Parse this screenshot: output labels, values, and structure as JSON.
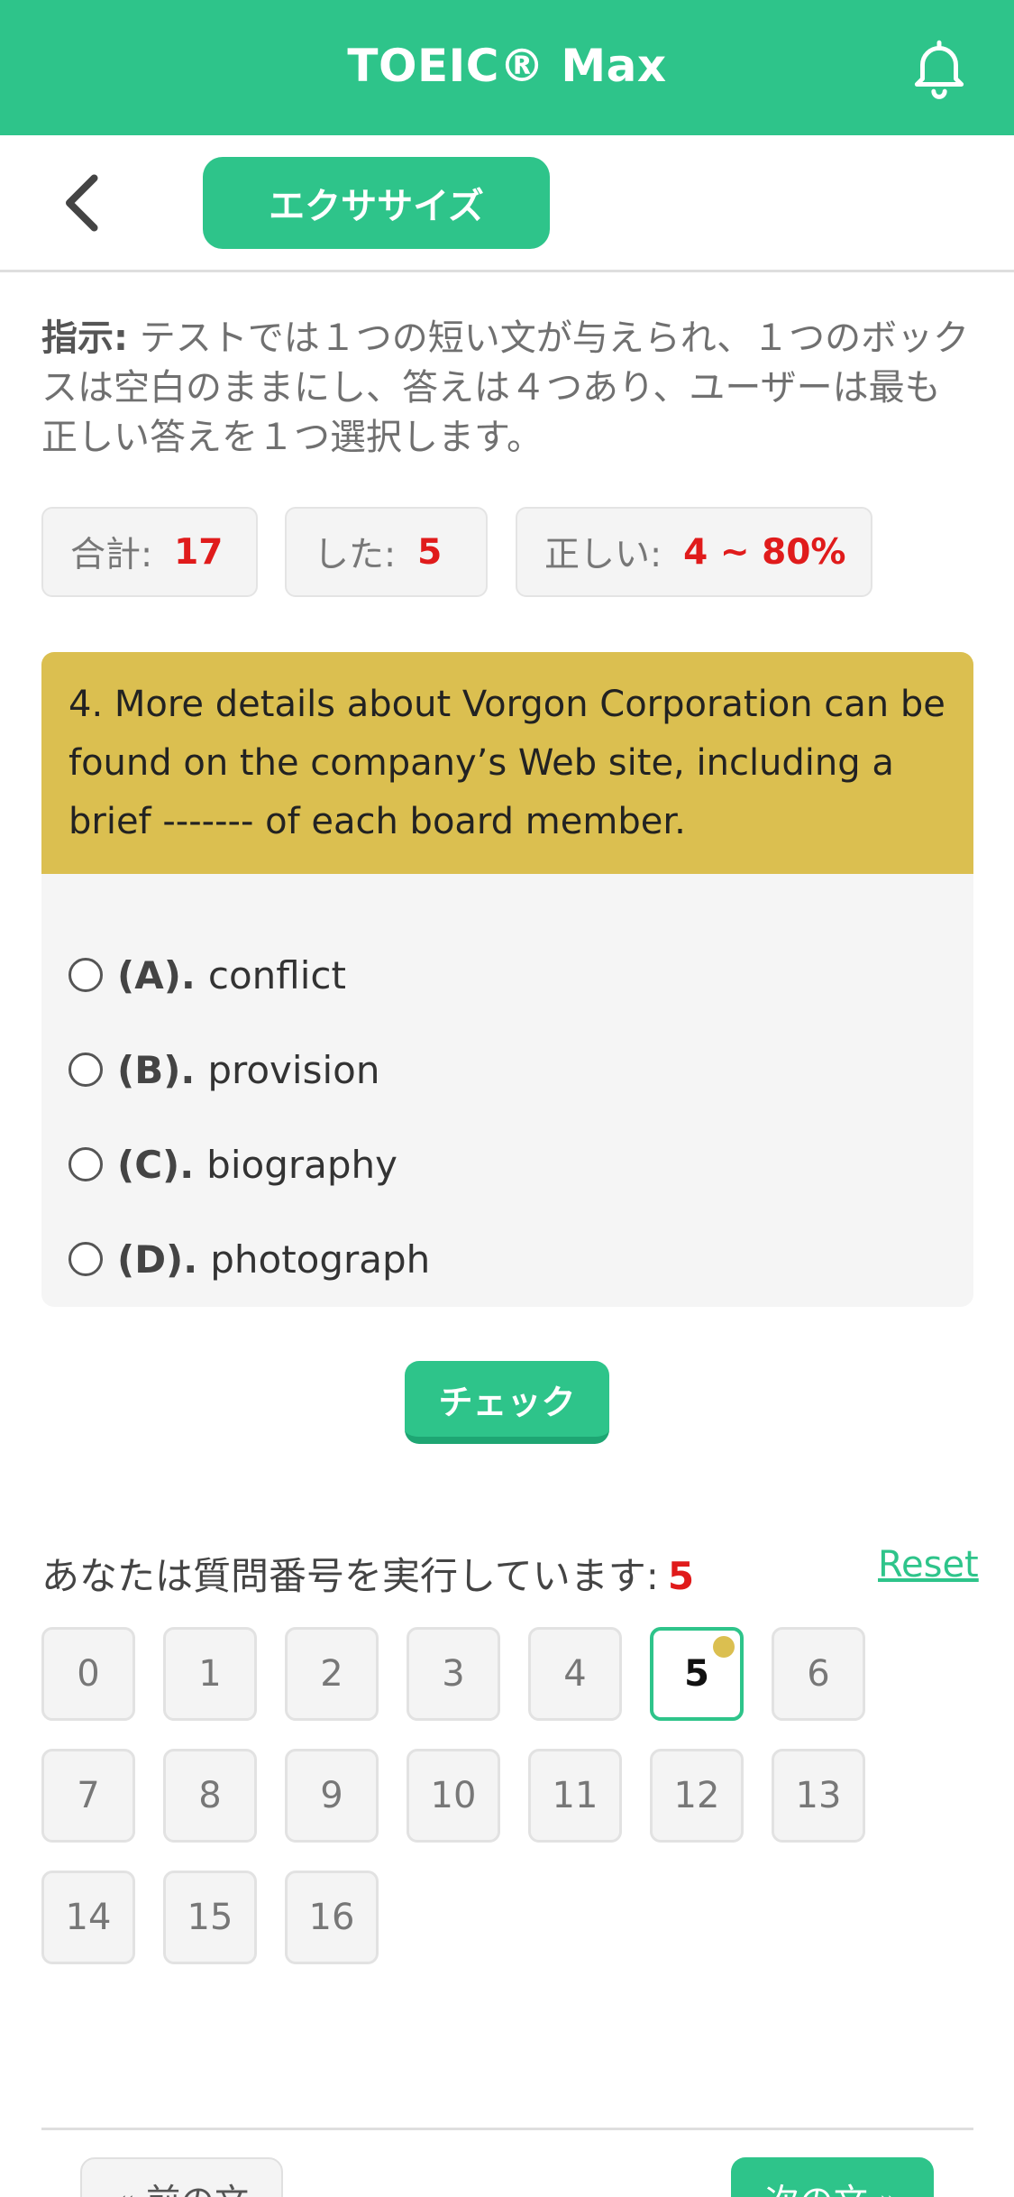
{
  "app": {
    "title": "TOEIC® Max",
    "bell_icon": "bell-icon",
    "back_icon": "chevron-left-icon"
  },
  "subnav": {
    "tab_label": "エクササイズ"
  },
  "instruction": {
    "label": "指示:",
    "text": " テストでは１つの短い文が与えられ、１つのボックスは空白のままにし、答えは４つあり、ユーザーは最も正しい答えを１つ選択します。"
  },
  "stats": {
    "total_label": "合計:",
    "total_value": "17",
    "done_label": "した:",
    "done_value": "5",
    "correct_label": "正しい:",
    "correct_value": "4 ~ 80%"
  },
  "question": {
    "text": "4. More details about Vorgon Corporation can be found on the company’s Web site, including a brief ------- of each board member.",
    "options": [
      {
        "letter": "(A).",
        "text": "conflict"
      },
      {
        "letter": "(B).",
        "text": "provision"
      },
      {
        "letter": "(C).",
        "text": "biography"
      },
      {
        "letter": "(D).",
        "text": "photograph"
      }
    ]
  },
  "check_label": "チェック",
  "progress": {
    "label": "あなたは質問番号を実行しています:",
    "current": "5",
    "reset_label": "Reset",
    "numbers": [
      "0",
      "1",
      "2",
      "3",
      "4",
      "5",
      "6",
      "7",
      "8",
      "9",
      "10",
      "11",
      "12",
      "13",
      "14",
      "15",
      "16"
    ]
  },
  "nav": {
    "prev_label": "« 前の文",
    "next_label": "次の文 »"
  },
  "colors": {
    "accent": "#2ec48a",
    "question_bg": "#dbbf50",
    "highlight": "#e01b1b"
  }
}
